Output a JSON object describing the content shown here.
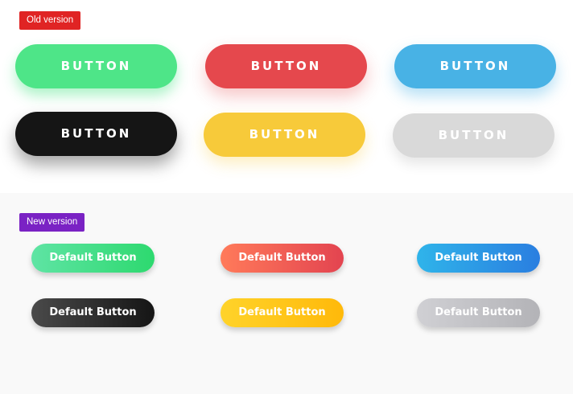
{
  "old_section": {
    "badge": "Old version",
    "buttons": [
      {
        "label": "BUTTON",
        "color": "#4ee588"
      },
      {
        "label": "BUTTON",
        "color": "#e5484d"
      },
      {
        "label": "BUTTON",
        "color": "#48b2e5"
      },
      {
        "label": "BUTTON",
        "color": "#151515"
      },
      {
        "label": "BUTTON",
        "color": "#f7ca3a"
      },
      {
        "label": "BUTTON",
        "color": "#d9d9d9"
      }
    ]
  },
  "new_section": {
    "badge": "New version",
    "buttons": [
      {
        "label": "Default Button",
        "gradient": [
          "#5fe4a4",
          "#2dd96f"
        ]
      },
      {
        "label": "Default Button",
        "gradient": [
          "#ff7a5a",
          "#e34450"
        ]
      },
      {
        "label": "Default Button",
        "gradient": [
          "#2fb4ea",
          "#2a7ee0"
        ]
      },
      {
        "label": "Default Button",
        "gradient": [
          "#4a4a4a",
          "#151515"
        ]
      },
      {
        "label": "Default Button",
        "gradient": [
          "#ffd32a",
          "#ffb90a"
        ]
      },
      {
        "label": "Default Button",
        "gradient": [
          "#d0d0d4",
          "#b3b3b7"
        ]
      }
    ]
  }
}
